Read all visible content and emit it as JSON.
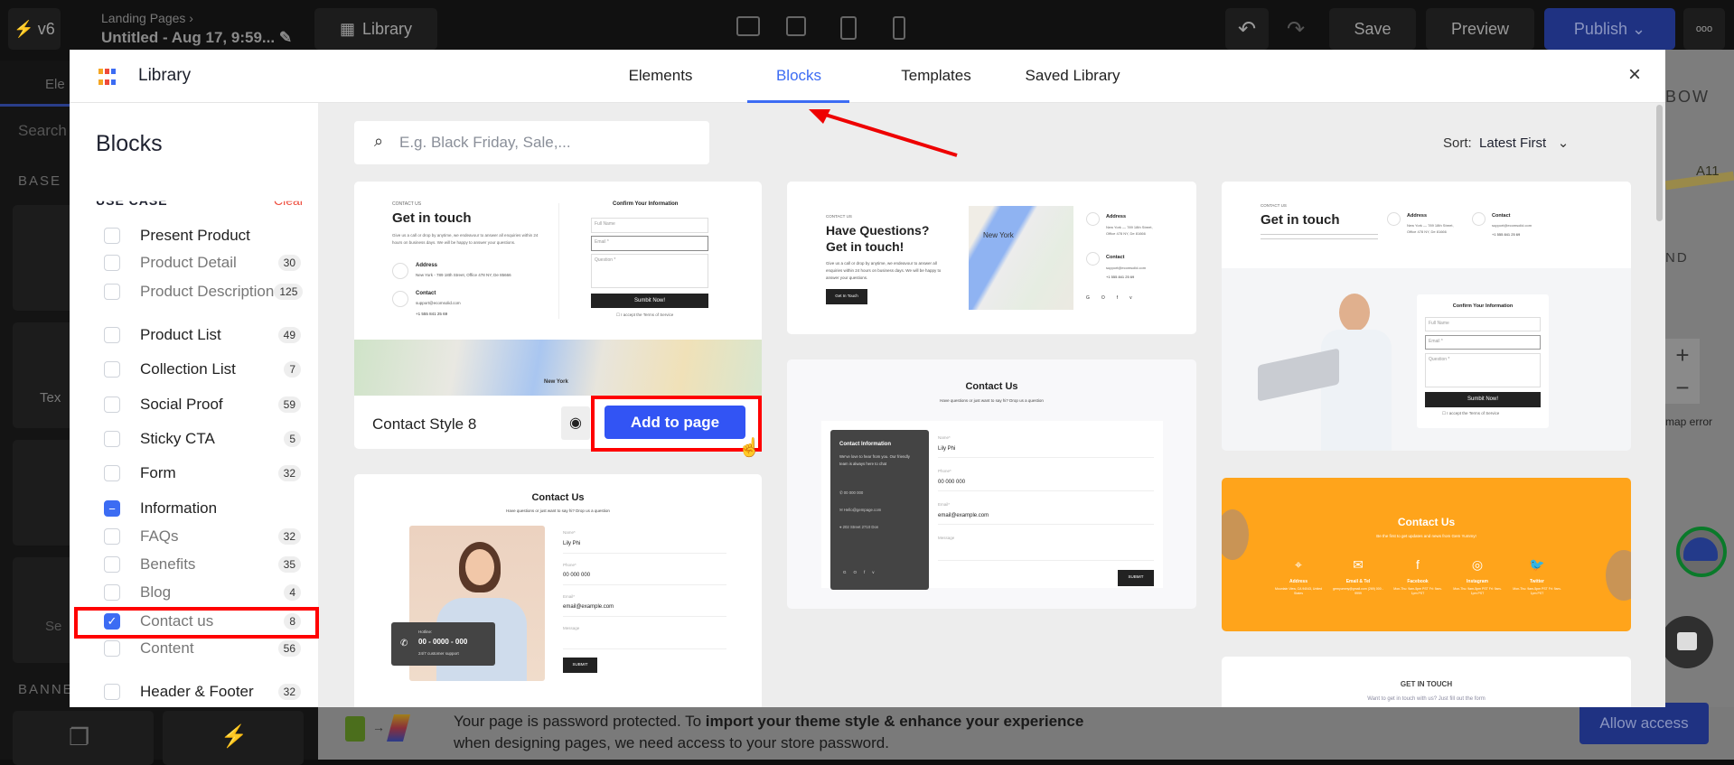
{
  "topbar": {
    "version": "v6",
    "breadcrumb": "Landing Pages",
    "page_title": "Untitled - Aug 17, 9:59...",
    "library_label": "Library",
    "save": "Save",
    "preview": "Preview",
    "publish": "Publish",
    "more": "ooo"
  },
  "editor_sidebar": {
    "tab": "Ele",
    "search": "Search",
    "section_base": "BASE",
    "tile1": "Tex",
    "tile2": "Se",
    "section_banner": "BANNE"
  },
  "modal": {
    "title": "Library",
    "tabs": [
      {
        "label": "Elements"
      },
      {
        "label": "Blocks",
        "active": true
      },
      {
        "label": "Templates"
      },
      {
        "label": "Saved Library"
      }
    ],
    "close": "×",
    "sidebar": {
      "heading": "Blocks",
      "group": "USE CASE",
      "clear": "Clear",
      "items": [
        {
          "label": "Present Product",
          "count": "",
          "state": "unchecked",
          "sub": false
        },
        {
          "label": "Product Detail",
          "count": "30",
          "state": "unchecked",
          "sub": true
        },
        {
          "label": "Product Description",
          "count": "125",
          "state": "unchecked",
          "sub": true
        },
        {
          "label": "Product List",
          "count": "49",
          "state": "unchecked",
          "sub": false
        },
        {
          "label": "Collection List",
          "count": "7",
          "state": "unchecked",
          "sub": false
        },
        {
          "label": "Social Proof",
          "count": "59",
          "state": "unchecked",
          "sub": false
        },
        {
          "label": "Sticky CTA",
          "count": "5",
          "state": "unchecked",
          "sub": false
        },
        {
          "label": "Form",
          "count": "32",
          "state": "unchecked",
          "sub": false
        },
        {
          "label": "Information",
          "count": "",
          "state": "indeterminate",
          "sub": false
        },
        {
          "label": "FAQs",
          "count": "32",
          "state": "unchecked",
          "sub": true
        },
        {
          "label": "Benefits",
          "count": "35",
          "state": "unchecked",
          "sub": true
        },
        {
          "label": "Blog",
          "count": "4",
          "state": "unchecked",
          "sub": true
        },
        {
          "label": "Contact us",
          "count": "8",
          "state": "checked",
          "sub": true
        },
        {
          "label": "Content",
          "count": "56",
          "state": "unchecked",
          "sub": true
        },
        {
          "label": "Header & Footer",
          "count": "32",
          "state": "unchecked",
          "sub": false
        }
      ]
    },
    "search": {
      "placeholder": "E.g. Black Friday, Sale,..."
    },
    "sort": {
      "label": "Sort:",
      "value": "Latest First"
    },
    "cards": {
      "c1": {
        "name": "Contact Style 8",
        "add": "Add to page",
        "eyebrow": "CONTACT US",
        "heading": "Get in touch",
        "desc": "Give us a call or drop by anytime, we endeavour to answer all enquiries within 24 hours on business days. We will be happy to answer your questions.",
        "address_label": "Address",
        "address": "New York - 789 18th Street, Office 478 NY, De 85666",
        "contact_label": "Contact",
        "email": "support@ecomsolid.com",
        "phone": "+1 555 841 25 69",
        "form_title": "Confirm Your Information",
        "full_name": "Full Name",
        "email_field": "Email *",
        "question": "Question *",
        "submit": "Sumbit Now!",
        "terms": "I accept the Terms of Service",
        "map_city": "New York"
      },
      "c2": {
        "heading": "Contact Us",
        "sub": "Have questions or just want to say hi? Drop us a question",
        "name_label": "Name*",
        "name": "Lily Phi",
        "phone_label": "Phone*",
        "phone": "00 000 000",
        "email_label": "Email*",
        "email": "email@example.com",
        "message": "Message",
        "submit": "SUBMIT",
        "hotline_label": "Hotline:",
        "hotline": "00 - 0000 - 000",
        "support": "24/7 customer support"
      },
      "c3": {
        "eyebrow": "CONTACT US",
        "heading1": "Have Questions?",
        "heading2": "Get in touch!",
        "desc": "Give us a call or drop by anytime, we endeavour to answer all enquiries within 24 hours on business days. We will be happy to answer your questions.",
        "button": "Get In Touch",
        "map_city": "New York",
        "address_label": "Address",
        "address": "New York — 789 18th Street, Office 478 NY, De 81666",
        "contact_label": "Contact",
        "email": "support@ecomsolid.com",
        "phone": "+1 555 841 25 69"
      },
      "c4": {
        "heading": "Contact Us",
        "sub": "Have questions or just want to say hi? Drop us a question",
        "info_title": "Contact Information",
        "info_desc": "We've love to hear from you. Our friendly team is always here to chat",
        "phone": "00 000 000",
        "email": "Hello@gempage.com",
        "address": "202 Street 2710 Don",
        "name_label": "Name*",
        "name": "Lily Phi",
        "phone_label": "Phone*",
        "phone_val": "00 000 000",
        "email_label": "Email*",
        "email_val": "email@example.com",
        "message": "Message",
        "submit": "SUBMIT"
      },
      "c5": {
        "eyebrow": "CONTACT US",
        "heading": "Get in touch",
        "address_label": "Address",
        "address": "New York — 789 18th Street, Office 478 NY, De 81666",
        "contact_label": "Contact",
        "email": "support@ecomsolid.com",
        "phone": "+1 555 841 25 69",
        "form_title": "Confirm Your Information",
        "full_name": "Full Name",
        "email_field": "Email *",
        "question": "Question *",
        "submit": "Sumbit Now!",
        "terms": "I accept the Terms of Service"
      },
      "c6": {
        "heading": "Contact Us",
        "sub": "Be the first to get updates and news from Gem Yummy!",
        "cols": [
          {
            "t": "Address",
            "d": "Mountain View, CA 94043, United States"
          },
          {
            "t": "Email & Tel",
            "d": "gemyummy@gmail.com (269) 000 - 9999"
          },
          {
            "t": "Facebook",
            "d": "Mon-Thu: 9am-5pm PST Fri: 9am-1pm PST"
          },
          {
            "t": "Instagram",
            "d": "Mon-Thu: 9am-5pm PST Fri: 9am-1pm PST"
          },
          {
            "t": "Twitter",
            "d": "Mon-Thu: 9am-5pm PST Fri: 9am-1pm PST"
          }
        ],
        "accent": "#FFA41B"
      },
      "c7": {
        "heading": "GET IN TOUCH",
        "sub": "Want to get in touch with us? Just fill out the form"
      }
    }
  },
  "map_overlay": {
    "label1": "BOW",
    "label2": "A11",
    "label3": "ND",
    "error": "map error"
  },
  "banner": {
    "text1": "Your page is password protected. To ",
    "text_bold": "import your theme style & enhance your experience",
    "text2": "when designing pages, we need access to your store password.",
    "button": "Allow access"
  },
  "colors": {
    "accent": "#3C6CF3",
    "publish": "#1F3282",
    "highlight": "#FF0000"
  }
}
